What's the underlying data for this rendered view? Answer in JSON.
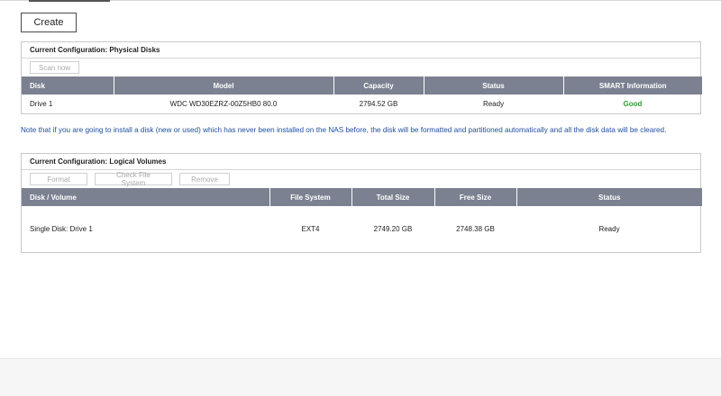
{
  "toolbar": {
    "create_label": "Create"
  },
  "physical_disks": {
    "title": "Current Configuration: Physical Disks",
    "scan_label": "Scan now",
    "columns": [
      "Disk",
      "Model",
      "Capacity",
      "Status",
      "SMART Information"
    ],
    "rows": [
      {
        "disk": "Drive 1",
        "model": "WDC WD30EZRZ-00Z5HB0 80.0",
        "capacity": "2794.52 GB",
        "status": "Ready",
        "smart": "Good"
      }
    ]
  },
  "note": "Note that if you are going to install a disk (new or used) which has never been installed on the NAS before, the disk will be formatted and partitioned automatically and all the disk data will be cleared.",
  "logical_volumes": {
    "title": "Current Configuration: Logical Volumes",
    "buttons": {
      "format": "Format",
      "check": "Check File System",
      "remove": "Remove"
    },
    "columns": [
      "Disk / Volume",
      "File System",
      "Total Size",
      "Free Size",
      "Status"
    ],
    "rows": [
      {
        "volume": "Single Disk: Drive 1",
        "fs": "EXT4",
        "total": "2749.20 GB",
        "free": "2748.38 GB",
        "status": "Ready"
      }
    ]
  },
  "colors": {
    "header_bg": "#7b8190",
    "note_text": "#1f4fa0",
    "smart_good": "#2f9e2f"
  }
}
